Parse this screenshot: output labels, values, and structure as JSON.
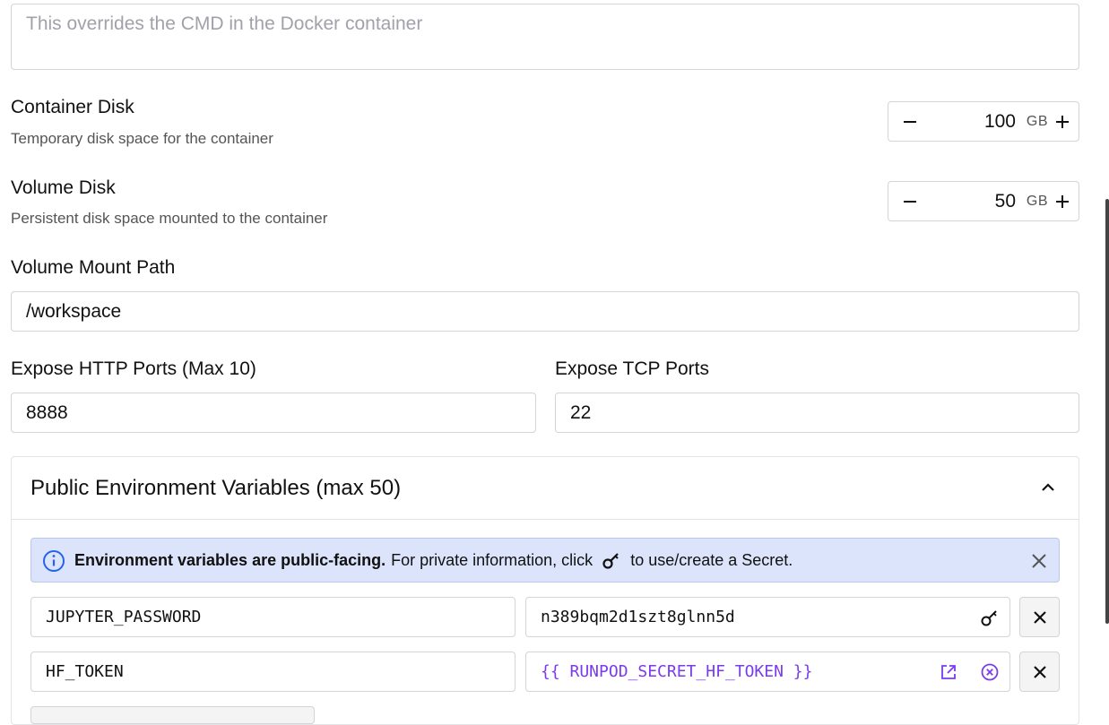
{
  "start_command": {
    "placeholder": "This overrides the CMD in the Docker container",
    "value": ""
  },
  "container_disk": {
    "label": "Container Disk",
    "description": "Temporary disk space for the container",
    "value": "100",
    "unit": "GB"
  },
  "volume_disk": {
    "label": "Volume Disk",
    "description": "Persistent disk space mounted to the container",
    "value": "50",
    "unit": "GB"
  },
  "volume_mount": {
    "label": "Volume Mount Path",
    "value": "/workspace"
  },
  "http_ports": {
    "label": "Expose HTTP Ports (Max 10)",
    "value": "8888"
  },
  "tcp_ports": {
    "label": "Expose TCP Ports",
    "value": "22"
  },
  "env_section": {
    "title": "Public Environment Variables (max 50)",
    "notice": {
      "bold": "Environment variables are public-facing.",
      "text_before_icon": "For private information, click",
      "text_after_icon": "to use/create a Secret."
    },
    "vars": [
      {
        "key": "JUPYTER_PASSWORD",
        "value": "n389bqm2d1szt8glnn5d"
      },
      {
        "key": "HF_TOKEN",
        "value": "{{ RUNPOD_SECRET_HF_TOKEN }}"
      }
    ]
  },
  "colors": {
    "notice_bg": "#dbe4fb",
    "notice_border": "#bac8f0",
    "accent_blue": "#2563eb",
    "secret_purple": "#7c3aed"
  }
}
